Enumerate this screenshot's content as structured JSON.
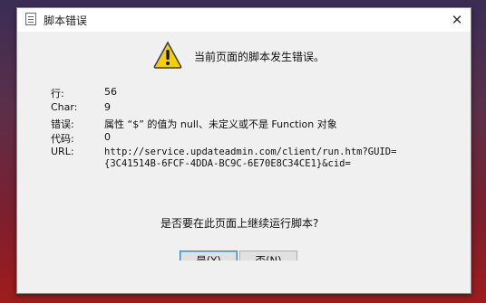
{
  "window": {
    "title": "脚本错误",
    "close_glyph": "✕"
  },
  "message": "当前页面的脚本发生错误。",
  "details": {
    "line_label": "行:",
    "line_value": "56",
    "char_label": "Char:",
    "char_value": "9",
    "error_label": "错误:",
    "error_value": "属性 “$” 的值为 null、未定义或不是 Function 对象",
    "code_label": "代码:",
    "code_value": "0",
    "url_label": "URL:",
    "url_line1": "http://service.updateadmin.com/client/run.htm?GUID=",
    "url_line2": "{3C41514B-6FCF-4DDA-BC9C-6E70E8C34CE1}&cid="
  },
  "question": "是否要在此页面上继续运行脚本?",
  "buttons": {
    "yes": "是(Y)",
    "no": "否(N)"
  },
  "icons": {
    "title_icon": "page-icon",
    "warning_icon": "warning-triangle-icon",
    "warning_color": "#f5d000"
  }
}
